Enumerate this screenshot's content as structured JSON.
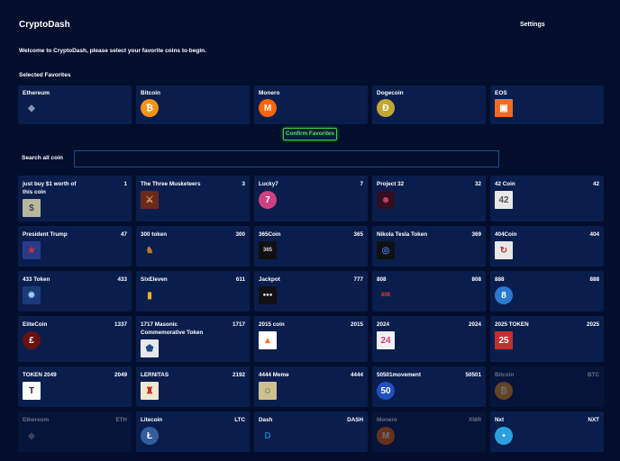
{
  "header": {
    "title": "CryptoDash",
    "settings": "Settings"
  },
  "welcome": "Welcome to CryptoDash, please select your favorite coins to begin.",
  "favorites_heading": "Selected Favorites",
  "favorites": [
    {
      "name": "Ethereum",
      "icon": "ethereum-icon",
      "bg": "transparent",
      "fg": "#8a92b2",
      "glyph": "◆",
      "shape": "sq"
    },
    {
      "name": "Bitcoin",
      "icon": "bitcoin-icon",
      "bg": "#f7931a",
      "fg": "#fff",
      "glyph": "₿",
      "shape": "circ"
    },
    {
      "name": "Monero",
      "icon": "monero-icon",
      "bg": "#ff6600",
      "fg": "#fff",
      "glyph": "M",
      "shape": "circ"
    },
    {
      "name": "Dogecoin",
      "icon": "dogecoin-icon",
      "bg": "#c2a633",
      "fg": "#fff",
      "glyph": "Ð",
      "shape": "circ"
    },
    {
      "name": "EOS",
      "icon": "eos-icon",
      "bg": "#f26b22",
      "fg": "#fff",
      "glyph": "▣",
      "shape": "sq"
    }
  ],
  "confirm_label": "Confirm Favorites",
  "search": {
    "label": "Search all coin",
    "value": ""
  },
  "coins": [
    {
      "name": "just buy $1 worth of this coin",
      "symbol": "1",
      "icon": "dollar-bill-icon",
      "bg": "#b9b6a0",
      "fg": "#444",
      "glyph": "$",
      "shape": "sq"
    },
    {
      "name": "The Three Musketeers",
      "symbol": "3",
      "icon": "musketeers-icon",
      "bg": "#6a2a1a",
      "fg": "#e0a070",
      "glyph": "⚔",
      "shape": "sq"
    },
    {
      "name": "Lucky7",
      "symbol": "7",
      "icon": "lucky7-icon",
      "bg": "#d04080",
      "fg": "#fff",
      "glyph": "7",
      "shape": "circ"
    },
    {
      "name": "Project 32",
      "symbol": "32",
      "icon": "project32-icon",
      "bg": "#301020",
      "fg": "#e04060",
      "glyph": "☻",
      "shape": "sq"
    },
    {
      "name": "42 Coin",
      "symbol": "42",
      "icon": "42coin-icon",
      "bg": "#e8e8e8",
      "fg": "#555",
      "glyph": "42",
      "shape": "sq"
    },
    {
      "name": "President Trump",
      "symbol": "47",
      "icon": "trump-icon",
      "bg": "#2a3a8a",
      "fg": "#d03030",
      "glyph": "★",
      "shape": "sq"
    },
    {
      "name": "300 token",
      "symbol": "300",
      "icon": "spartan-helmet-icon",
      "bg": "transparent",
      "fg": "#b87a30",
      "glyph": "♞",
      "shape": "sq"
    },
    {
      "name": "365Coin",
      "symbol": "365",
      "icon": "365coin-icon",
      "bg": "#111",
      "fg": "#ddd",
      "glyph": "365",
      "shape": "sq"
    },
    {
      "name": "Nikola Tesla Token",
      "symbol": "369",
      "icon": "tesla-icon",
      "bg": "#111",
      "fg": "#4070e0",
      "glyph": "◎",
      "shape": "sq"
    },
    {
      "name": "404Coin",
      "symbol": "404",
      "icon": "404coin-icon",
      "bg": "#e8e8e8",
      "fg": "#c03030",
      "glyph": "↻",
      "shape": "sq"
    },
    {
      "name": "433 Token",
      "symbol": "433",
      "icon": "433token-icon",
      "bg": "#1a3a7a",
      "fg": "#9cf",
      "glyph": "✹",
      "shape": "sq"
    },
    {
      "name": "SixEleven",
      "symbol": "611",
      "icon": "coin-stack-icon",
      "bg": "transparent",
      "fg": "#f0b030",
      "glyph": "▮",
      "shape": "sq"
    },
    {
      "name": "Jackpot",
      "symbol": "777",
      "icon": "jackpot-icon",
      "bg": "#111",
      "fg": "#fff",
      "glyph": "●●●",
      "shape": "sq"
    },
    {
      "name": "808",
      "symbol": "808",
      "icon": "808-icon",
      "bg": "transparent",
      "fg": "#e04020",
      "glyph": "808",
      "shape": "sq"
    },
    {
      "name": "888",
      "symbol": "888",
      "icon": "888-icon",
      "bg": "#2a7ad0",
      "fg": "#fff",
      "glyph": "8",
      "shape": "circ"
    },
    {
      "name": "EliteCoin",
      "symbol": "1337",
      "icon": "elitecoin-icon",
      "bg": "#6a1010",
      "fg": "#fff",
      "glyph": "£",
      "shape": "circ"
    },
    {
      "name": "1717 Masonic Commemorative Token",
      "symbol": "1717",
      "icon": "masonic-icon",
      "bg": "#e8e8e8",
      "fg": "#1a4a8a",
      "glyph": "⬟",
      "shape": "sq"
    },
    {
      "name": "2015 coin",
      "symbol": "2015",
      "icon": "2015coin-icon",
      "bg": "#fff",
      "fg": "#f07020",
      "glyph": "▲",
      "shape": "sq"
    },
    {
      "name": "2024",
      "symbol": "2024",
      "icon": "2024-icon",
      "bg": "#f0f0f0",
      "fg": "#d04080",
      "glyph": "24",
      "shape": "sq"
    },
    {
      "name": "2025 TOKEN",
      "symbol": "2025",
      "icon": "2025token-icon",
      "bg": "#c03030",
      "fg": "#fff",
      "glyph": "25",
      "shape": "sq"
    },
    {
      "name": "TOKEN 2049",
      "symbol": "2049",
      "icon": "token2049-icon",
      "bg": "#fff",
      "fg": "#222",
      "glyph": "T",
      "shape": "sq"
    },
    {
      "name": "LERNITAS",
      "symbol": "2192",
      "icon": "lernitas-icon",
      "bg": "#f0e8d0",
      "fg": "#c03020",
      "glyph": "♜",
      "shape": "sq"
    },
    {
      "name": "4444 Meme",
      "symbol": "4444",
      "icon": "4444meme-icon",
      "bg": "#d0c090",
      "fg": "#3a7a30",
      "glyph": "☺",
      "shape": "sq"
    },
    {
      "name": "50501movement",
      "symbol": "50501",
      "icon": "50501-icon",
      "bg": "#2050c0",
      "fg": "#fff",
      "glyph": "50",
      "shape": "circ"
    },
    {
      "name": "Bitcoin",
      "symbol": "BTC",
      "icon": "bitcoin-icon",
      "bg": "#f7931a",
      "fg": "#fff",
      "glyph": "₿",
      "shape": "circ",
      "dim": true
    },
    {
      "name": "Ethereum",
      "symbol": "ETH",
      "icon": "ethereum-icon",
      "bg": "transparent",
      "fg": "#8a92b2",
      "glyph": "◆",
      "shape": "sq",
      "dim": true
    },
    {
      "name": "Litecoin",
      "symbol": "LTC",
      "icon": "litecoin-icon",
      "bg": "#345d9d",
      "fg": "#fff",
      "glyph": "Ł",
      "shape": "circ"
    },
    {
      "name": "Dash",
      "symbol": "DASH",
      "icon": "dash-icon",
      "bg": "transparent",
      "fg": "#1c75bc",
      "glyph": "D",
      "shape": "sq"
    },
    {
      "name": "Monero",
      "symbol": "XMR",
      "icon": "monero-icon",
      "bg": "#ff6600",
      "fg": "#fff",
      "glyph": "M",
      "shape": "circ",
      "dim": true
    },
    {
      "name": "Nxt",
      "symbol": "NXT",
      "icon": "nxt-icon",
      "bg": "#2aa0e0",
      "fg": "#fff",
      "glyph": "•",
      "shape": "circ"
    }
  ]
}
